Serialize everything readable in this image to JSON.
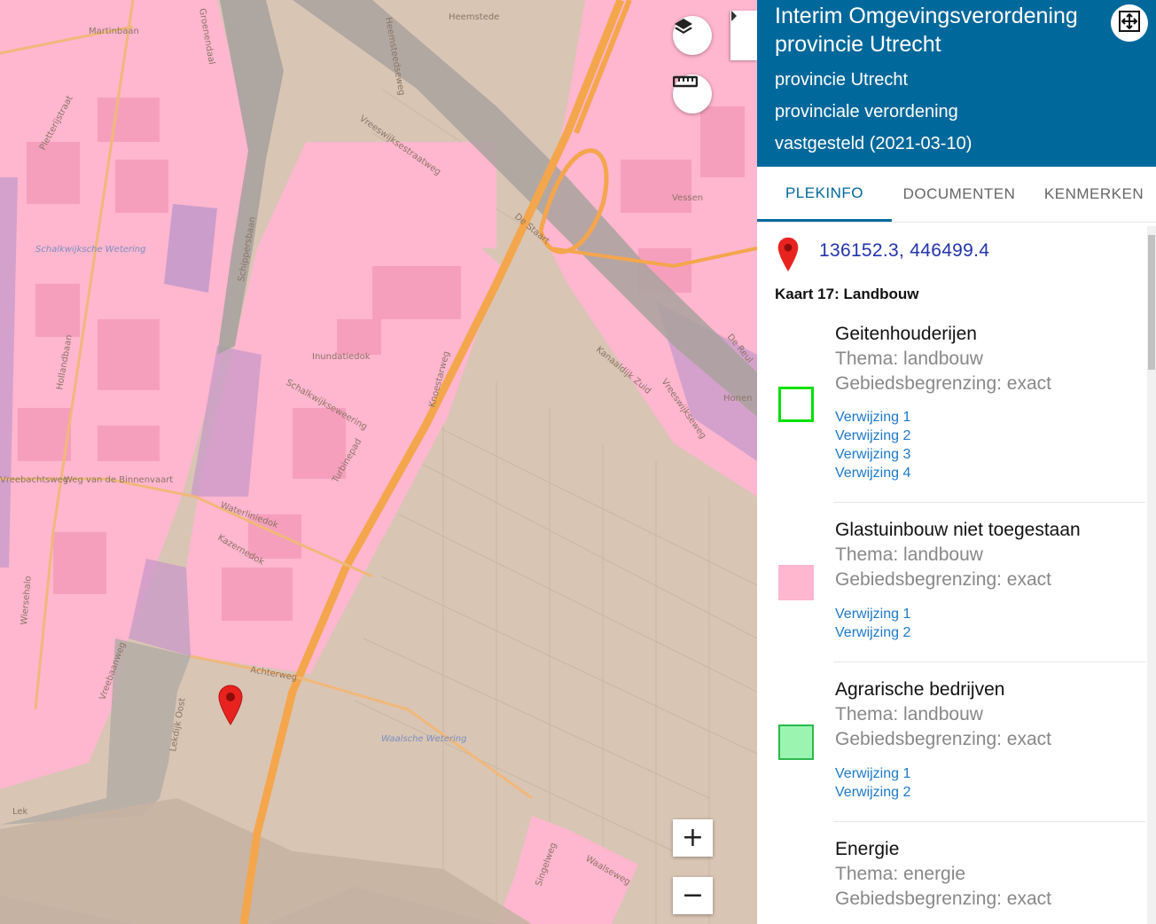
{
  "header": {
    "title": "Interim Omgevingsverordening provincie Utrecht",
    "line1": "provincie Utrecht",
    "line2": "provinciale verordening",
    "line3": "vastgesteld (2021-03-10)"
  },
  "tabs": [
    {
      "label": "PLEKINFO",
      "active": true
    },
    {
      "label": "DOCUMENTEN",
      "active": false
    },
    {
      "label": "KENMERKEN",
      "active": false
    }
  ],
  "location": {
    "coordinates": "136152.3, 446499.4"
  },
  "map_name": "Kaart 17: Landbouw",
  "features": [
    {
      "name": "Geitenhouderijen",
      "theme": "Thema: landbouw",
      "boundary": "Gebiedsbegrenzing: exact",
      "swatch_fill": "#ffffff",
      "swatch_border": "#00e000",
      "refs": [
        "Verwijzing 1",
        "Verwijzing 2",
        "Verwijzing 3",
        "Verwijzing 4"
      ]
    },
    {
      "name": "Glastuinbouw niet toegestaan",
      "theme": "Thema: landbouw",
      "boundary": "Gebiedsbegrenzing: exact",
      "swatch_fill": "#ffb6cf",
      "swatch_border": "#ffb6cf",
      "refs": [
        "Verwijzing 1",
        "Verwijzing 2"
      ]
    },
    {
      "name": "Agrarische bedrijven",
      "theme": "Thema: landbouw",
      "boundary": "Gebiedsbegrenzing: exact",
      "swatch_fill": "#9bf5b0",
      "swatch_border": "#2db84e",
      "refs": [
        "Verwijzing 1",
        "Verwijzing 2"
      ]
    },
    {
      "name": "Energie",
      "theme": "Thema: energie",
      "boundary": "Gebiedsbegrenzing: exact",
      "swatch_fill": "",
      "swatch_border": "",
      "refs": []
    }
  ],
  "map": {
    "labels": [
      "Martinbaan",
      "Pletterijstraat",
      "Groenendaal",
      "Heemstede",
      "Heemsteedseweg",
      "Schalkwijksche Wetering",
      "Hollandbaan",
      "Schippersbaan",
      "Vreeswijksestraatweg",
      "Inundatiedok",
      "Schalkwijkseweering",
      "De Staart",
      "Vessen",
      "De Reul",
      "Honen",
      "Kanaaldijk Zuid",
      "Vreeswijkseweg",
      "Knoestarweg",
      "Turbinepad",
      "Weg van de Binnenvaart",
      "Waterliniedok",
      "Kazernedok",
      "Achterweg",
      "Lekdijk Oost",
      "Waalsche Wetering",
      "Vreebaanweg",
      "Wiersehalo",
      "Vreebachtsweg",
      "Singelweg",
      "Waalseweg",
      "Lek"
    ],
    "colors": {
      "base": "#d9c5b4",
      "regulated_area": "#ffb6cf",
      "river": "#a9a29e",
      "highway": "#f4a64c"
    }
  },
  "controls": {
    "layers_icon": "layers-icon",
    "measure_icon": "ruler-icon",
    "collapse_icon": "chevron-right-icon",
    "zoom_in": "+",
    "zoom_out": "−",
    "fullscreen_icon": "fullscreen-icon"
  }
}
